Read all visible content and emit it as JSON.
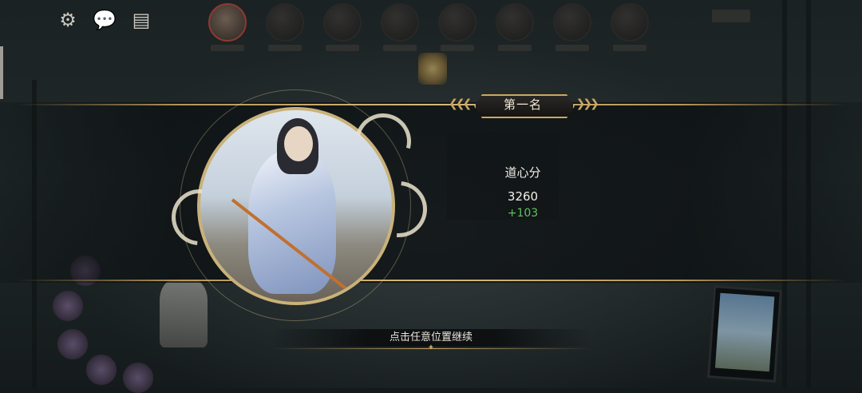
{
  "rank": {
    "label": "第一名"
  },
  "score": {
    "label": "道心分",
    "value": "3260",
    "delta": "+103"
  },
  "prompt": {
    "continue_label": "点击任意位置继续"
  },
  "top_icons": [
    "gear-icon",
    "chat-icon",
    "scroll-icon"
  ],
  "colors": {
    "accent_gold": "#c9a862",
    "delta_green": "#5ec25a"
  }
}
